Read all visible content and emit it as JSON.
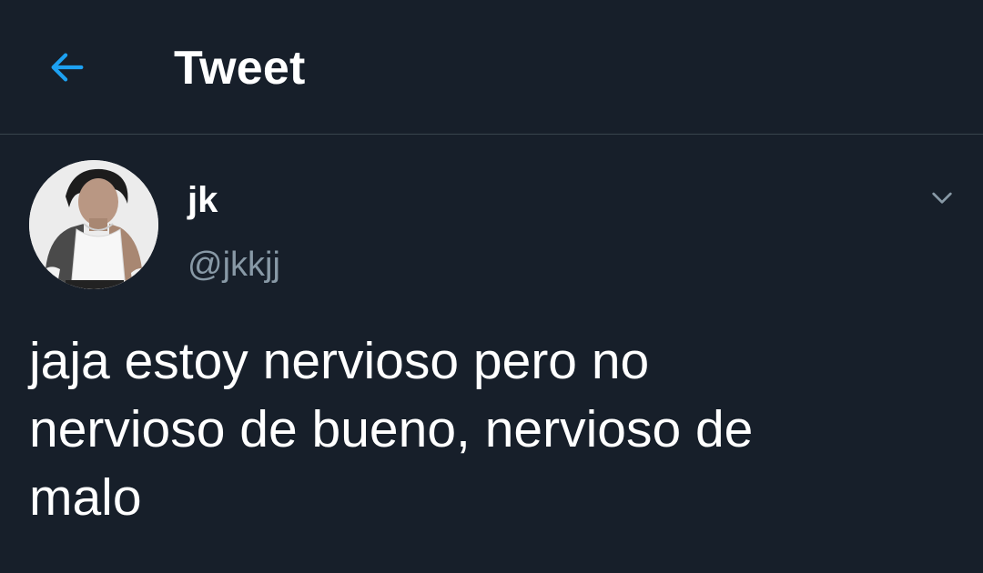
{
  "header": {
    "title": "Tweet",
    "back_icon": "arrow-left-icon",
    "accent_color": "#1da1f2"
  },
  "tweet": {
    "author": {
      "display_name": "jk",
      "handle": "@jkkjj",
      "avatar": "user-avatar"
    },
    "menu_icon": "chevron-down-icon",
    "text": "jaja estoy nervioso pero no\nnervioso de bueno, nervioso de\nmalo"
  },
  "theme": {
    "background": "#171f2a",
    "divider": "#38444d",
    "secondary_text": "#8899a6"
  }
}
